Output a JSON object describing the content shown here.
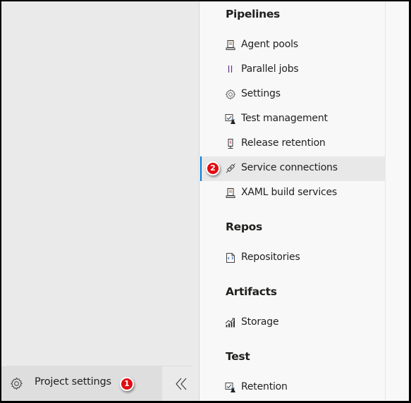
{
  "left_nav": {
    "project_settings_label": "Project settings",
    "project_settings_icon": "gear-icon",
    "project_settings_badge": "1",
    "collapse_icon": "double-chevron-left-icon"
  },
  "settings_nav": {
    "sections": [
      {
        "title": "Pipelines",
        "items": [
          {
            "label": "Agent pools",
            "icon": "agent-pool-icon"
          },
          {
            "label": "Parallel jobs",
            "icon": "parallel-jobs-icon"
          },
          {
            "label": "Settings",
            "icon": "gear-icon"
          },
          {
            "label": "Test management",
            "icon": "test-management-icon"
          },
          {
            "label": "Release retention",
            "icon": "release-retention-icon"
          },
          {
            "label": "Service connections",
            "icon": "plug-icon",
            "selected": true,
            "badge": "2"
          },
          {
            "label": "XAML build services",
            "icon": "build-server-icon"
          }
        ]
      },
      {
        "title": "Repos",
        "items": [
          {
            "label": "Repositories",
            "icon": "code-file-icon"
          }
        ]
      },
      {
        "title": "Artifacts",
        "items": [
          {
            "label": "Storage",
            "icon": "chart-growth-icon"
          }
        ]
      },
      {
        "title": "Test",
        "items": [
          {
            "label": "Retention",
            "icon": "test-retention-icon"
          }
        ]
      }
    ]
  },
  "colors": {
    "accent": "#0078d4",
    "badge": "#e20b12",
    "selected_bg": "#e8e8e8"
  }
}
